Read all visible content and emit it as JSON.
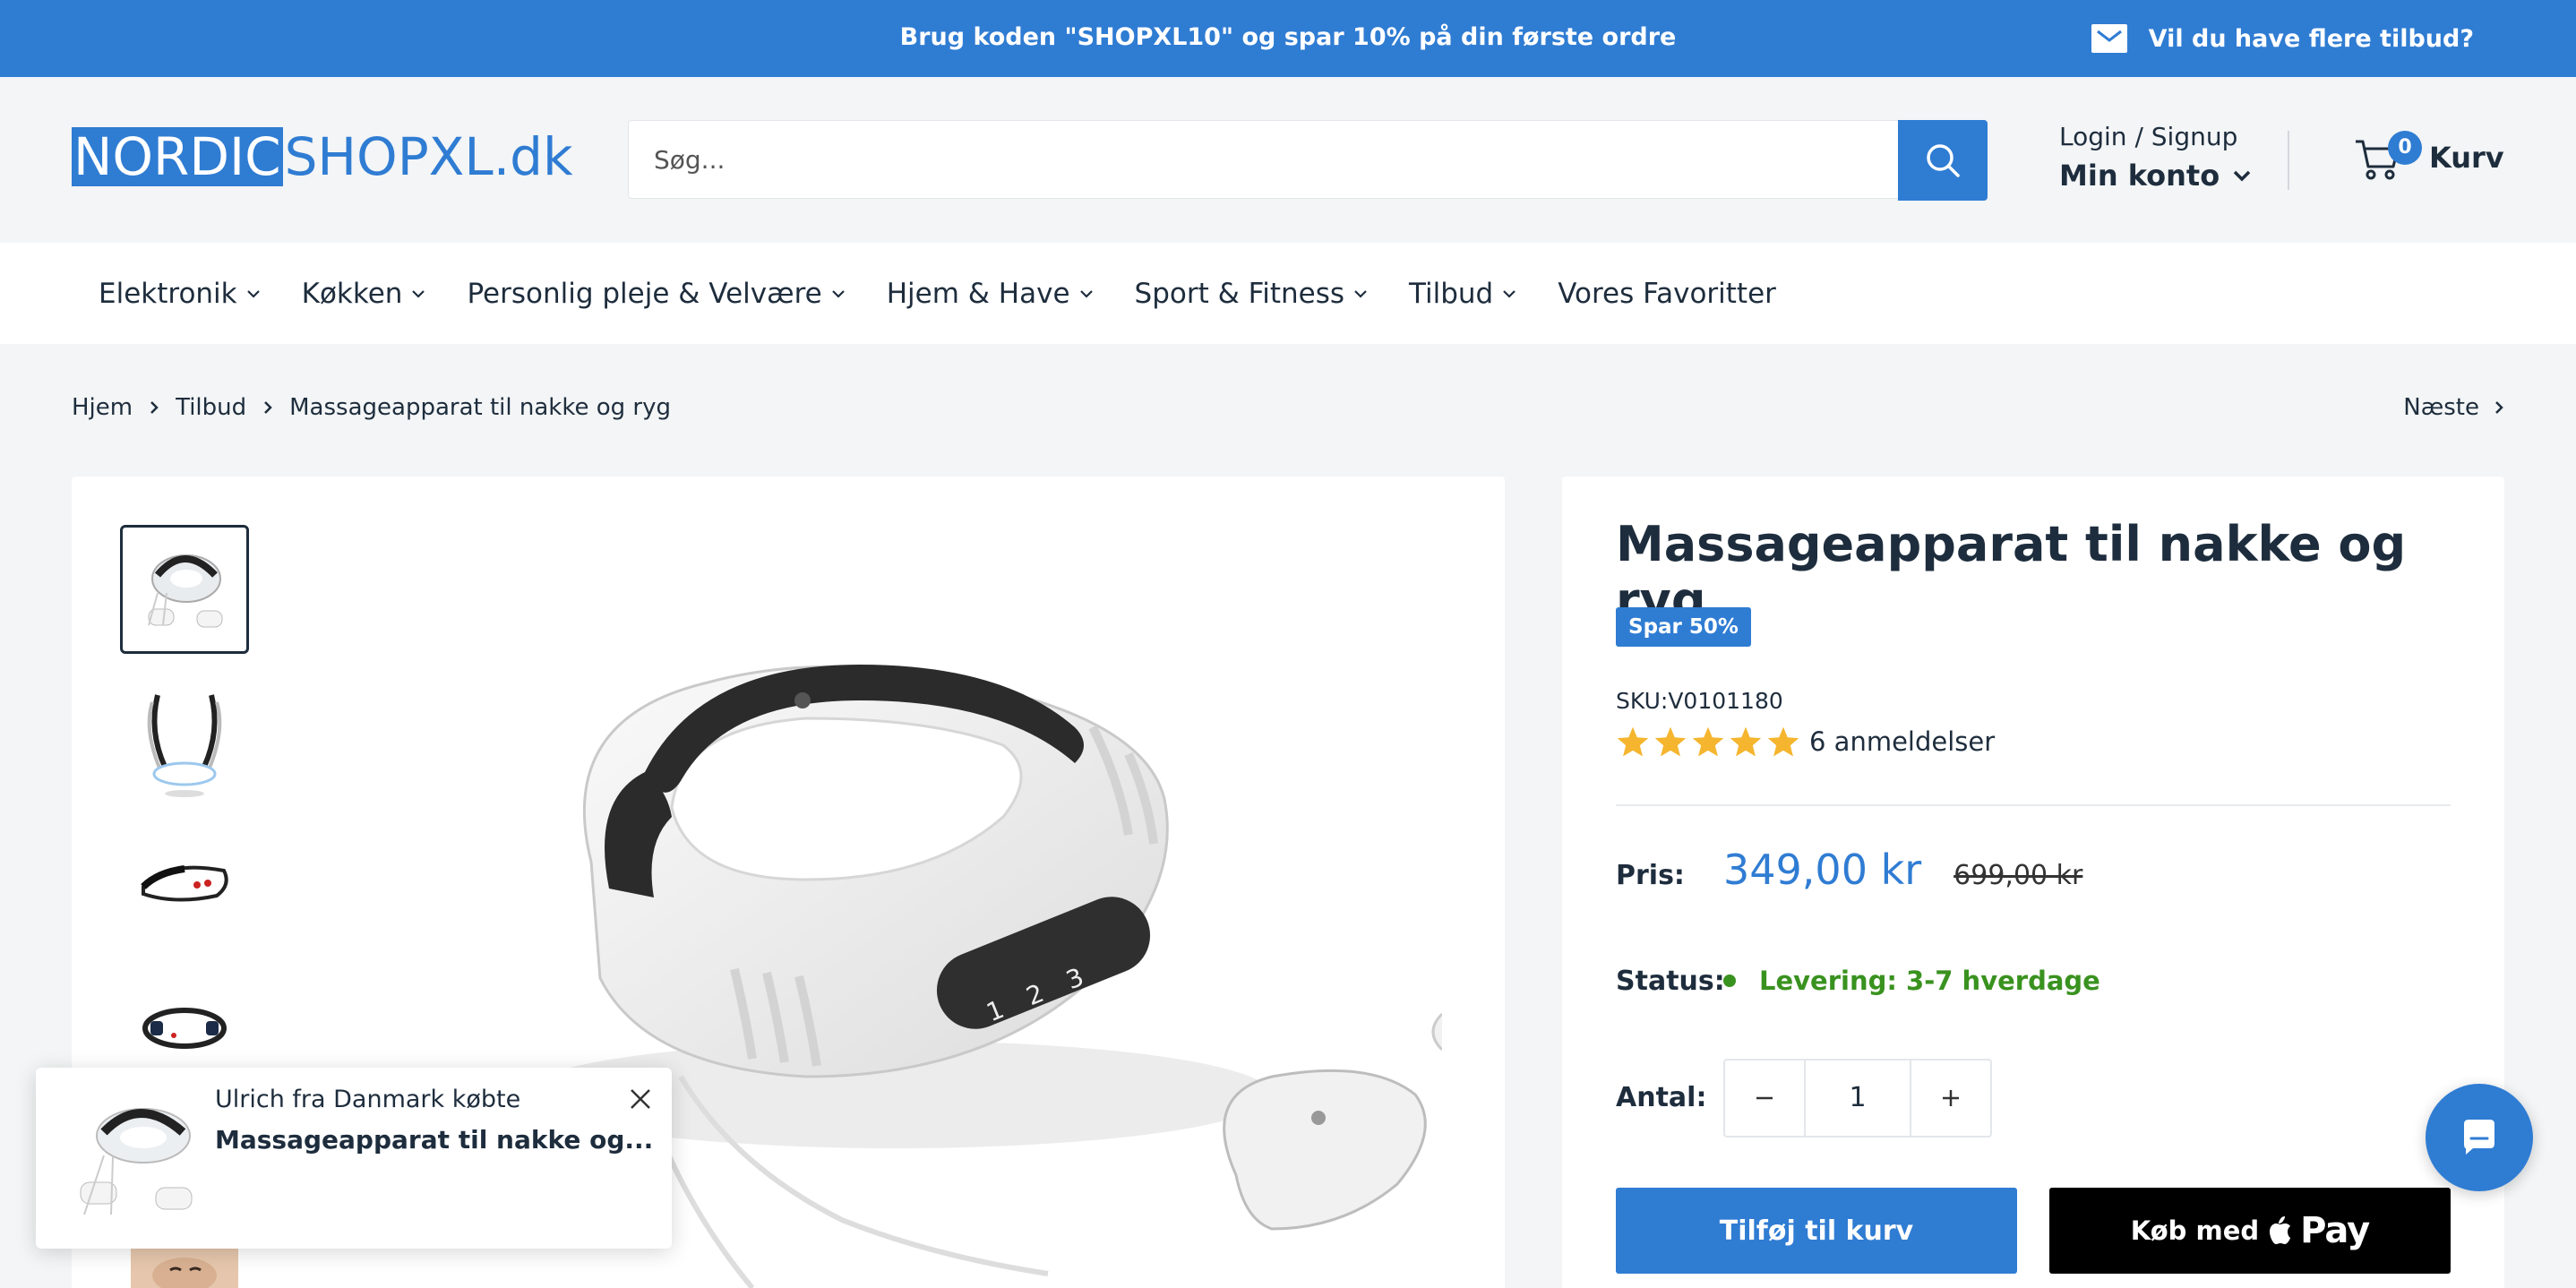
{
  "announcement": {
    "promo_text": "Brug koden \"SHOPXL10\" og spar 10% på din første ordre",
    "newsletter_text": "Vil du have flere tilbud?"
  },
  "header": {
    "logo_part1": "NORDIC",
    "logo_part2": "SHOPXL.dk",
    "search_placeholder": "Søg...",
    "login_label": "Login / Signup",
    "account_label": "Min konto",
    "cart_count": "0",
    "cart_label": "Kurv"
  },
  "nav": {
    "items": [
      {
        "label": "Elektronik",
        "dropdown": true
      },
      {
        "label": "Køkken",
        "dropdown": true
      },
      {
        "label": "Personlig pleje & Velvære",
        "dropdown": true
      },
      {
        "label": "Hjem & Have",
        "dropdown": true
      },
      {
        "label": "Sport & Fitness",
        "dropdown": true
      },
      {
        "label": "Tilbud",
        "dropdown": true
      },
      {
        "label": "Vores Favoritter",
        "dropdown": false
      }
    ]
  },
  "breadcrumb": {
    "items": [
      "Hjem",
      "Tilbud",
      "Massageapparat til nakke og ryg"
    ],
    "next_label": "Næste"
  },
  "product": {
    "title": "Massageapparat til nakke og ryg",
    "badge": "Spar 50%",
    "sku": "SKU:V0101180",
    "rating_stars": 5,
    "reviews": "6 anmeldelser",
    "price_label": "Pris:",
    "price_now": "349,00 kr",
    "price_was": "699,00 kr",
    "status_label": "Status:",
    "status_value": "Levering: 3-7 hverdage",
    "qty_label": "Antal:",
    "qty_value": "1",
    "add_to_cart": "Tilføj til kurv",
    "buy_with": "Køb med",
    "pay_label": "Pay"
  },
  "popup": {
    "who": "Ulrich fra Danmark købte",
    "product": "Massageapparat til nakke og..."
  },
  "colors": {
    "brand": "#2f7cd3",
    "status_green": "#39921f",
    "star": "#f5b52e"
  }
}
